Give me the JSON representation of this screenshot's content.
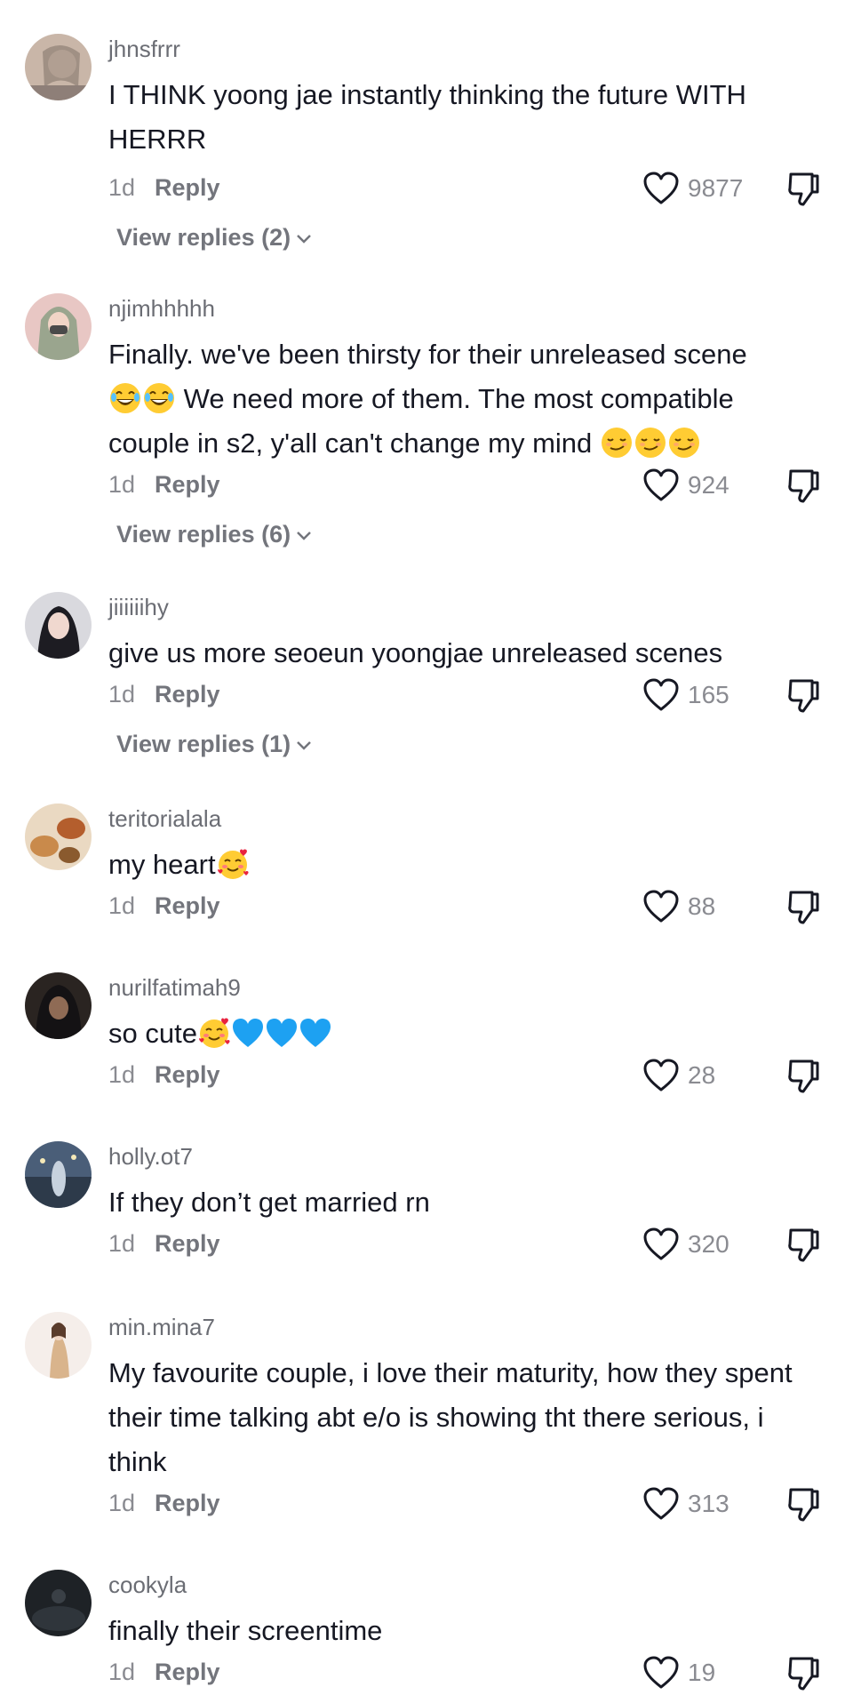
{
  "comments": [
    {
      "username": "jhnsfrrr",
      "text": "I THINK yoong jae instantly thinking the future WITH HERRR",
      "time": "1d",
      "reply": "Reply",
      "likes": "9877",
      "view_replies": "View replies (2)"
    },
    {
      "username": "njimhhhhh",
      "text_a": "Finally. we've been thirsty for their unreleased scene",
      "text_b": "We need more of them. The most compatible",
      "text_c": "couple in s2, y'all can't change my mind",
      "time": "1d",
      "reply": "Reply",
      "likes": "924",
      "view_replies": "View replies (6)"
    },
    {
      "username": "jiiiiiihy",
      "text": "give us more seoeun yoongjae unreleased scenes",
      "time": "1d",
      "reply": "Reply",
      "likes": "165",
      "view_replies": "View replies (1)"
    },
    {
      "username": "teritorialala",
      "text": "my heart",
      "time": "1d",
      "reply": "Reply",
      "likes": "88"
    },
    {
      "username": "nurilfatimah9",
      "text": "so cute",
      "time": "1d",
      "reply": "Reply",
      "likes": "28"
    },
    {
      "username": "holly.ot7",
      "text": "If they don’t get married rn",
      "time": "1d",
      "reply": "Reply",
      "likes": "320"
    },
    {
      "username": "min.mina7",
      "text": "My favourite couple, i love their maturity, how they spent their time talking abt e/o is showing tht there serious, i think",
      "time": "1d",
      "reply": "Reply",
      "likes": "313"
    },
    {
      "username": "cookyla",
      "text": "finally their screentime",
      "time": "1d",
      "reply": "Reply",
      "likes": "19"
    }
  ],
  "colors": {
    "primary_text": "#161823",
    "secondary_text": "#8a8b91",
    "heart_emoji_blue": "#1da1f2"
  },
  "icons": {
    "like": "heart-outline-icon",
    "dislike": "thumbs-down-outline-icon",
    "expand": "chevron-down-icon"
  }
}
